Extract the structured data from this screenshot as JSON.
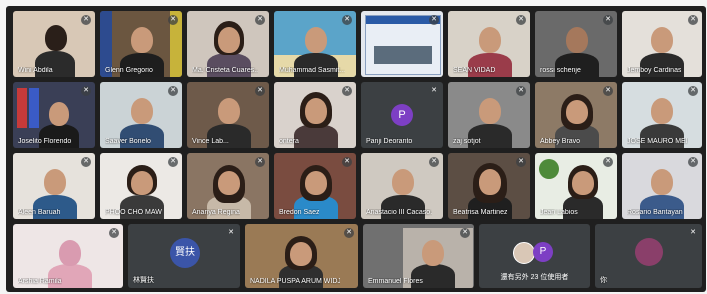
{
  "participants": [
    {
      "name": "Wini Abdila",
      "muted": true
    },
    {
      "name": "Glenn Gregorio",
      "muted": true
    },
    {
      "name": "Ma. Cristeta Cuares...",
      "muted": true
    },
    {
      "name": "Muhammad Sasmit...",
      "muted": true
    },
    {
      "name": "",
      "muted": true
    },
    {
      "name": "SEAN VIDAD",
      "muted": true
    },
    {
      "name": "rossi schenje",
      "muted": true
    },
    {
      "name": "Jemboy Cardinas",
      "muted": true
    },
    {
      "name": "Joselito Florendo",
      "muted": true
    },
    {
      "name": "Saaver Bonelo",
      "muted": true
    },
    {
      "name": "Vince Lab...",
      "muted": true
    },
    {
      "name": "ontera",
      "muted": true
    },
    {
      "name": "Panji Deoranto",
      "muted": true,
      "initial": "P"
    },
    {
      "name": "zaj sotjot",
      "muted": true
    },
    {
      "name": "Abbey Bravo",
      "muted": true
    },
    {
      "name": "JOSE MAURO MEI",
      "muted": true
    },
    {
      "name": "Aleen Baruah",
      "muted": true
    },
    {
      "name": "PHOO CHO MAW",
      "muted": true
    },
    {
      "name": "Ananya Regina",
      "muted": true
    },
    {
      "name": "Bredon Saez",
      "muted": true
    },
    {
      "name": "Anastacio III Cacaso...",
      "muted": true
    },
    {
      "name": "Beatrisa Martinez",
      "muted": true
    },
    {
      "name": "Jean Labios",
      "muted": true
    },
    {
      "name": "Rosario Bantayan",
      "muted": true
    },
    {
      "name": "Arshia Ramila",
      "muted": true
    },
    {
      "name": "林賢扶",
      "muted": true,
      "initial": "賢扶"
    },
    {
      "name": "NADILA PUSPA ARUM WIDJA...",
      "muted": true
    },
    {
      "name": "Emmanuel Flores",
      "muted": true
    },
    {
      "name": "",
      "muted": false
    },
    {
      "name": "你",
      "muted": true
    }
  ],
  "overflow": {
    "label": "還有另外 23 位使用者",
    "initial": "P"
  },
  "colors": {
    "panji_avatar": "#7d3fc4",
    "lin_avatar": "#3b55a8",
    "overflow_avatar": "#7d3fc4"
  }
}
